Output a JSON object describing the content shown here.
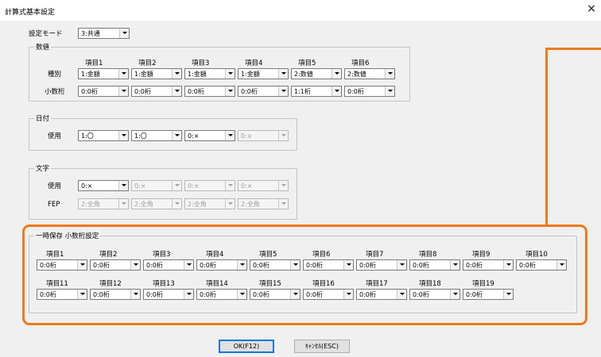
{
  "window": {
    "title": "計算式基本設定",
    "close_glyph": "×"
  },
  "mode": {
    "label": "設定モード",
    "value": "3:共通"
  },
  "numeric": {
    "title": "数値",
    "headers": [
      "項目1",
      "項目2",
      "項目3",
      "項目4",
      "項目5",
      "項目6"
    ],
    "type_label": "種別",
    "type_values": [
      "1:金額",
      "1:金額",
      "1:金額",
      "1:金額",
      "2:数値",
      "2:数値"
    ],
    "decimal_label": "小数桁",
    "decimal_values": [
      "0:0桁",
      "0:0桁",
      "0:0桁",
      "0:0桁",
      "1:1桁",
      "0:0桁"
    ]
  },
  "date": {
    "title": "日付",
    "use_label": "使用",
    "values": [
      "1:〇",
      "1:〇",
      "0:×",
      "0:×"
    ]
  },
  "text": {
    "title": "文字",
    "use_label": "使用",
    "use_values": [
      "0:×",
      "0:×",
      "0:×",
      "0:×"
    ],
    "fep_label": "FEP",
    "fep_values": [
      "2:全角",
      "2:全角",
      "2:全角",
      "2:全角"
    ]
  },
  "temp": {
    "title": "一時保存 小数桁設定",
    "row1_headers": [
      "項目1",
      "項目2",
      "項目3",
      "項目4",
      "項目5",
      "項目6",
      "項目7",
      "項目8",
      "項目9",
      "項目10"
    ],
    "row1_values": [
      "0:0桁",
      "0:0桁",
      "0:0桁",
      "0:0桁",
      "0:0桁",
      "0:0桁",
      "0:0桁",
      "0:0桁",
      "0:0桁",
      "0:0桁"
    ],
    "row2_headers": [
      "項目11",
      "項目12",
      "項目13",
      "項目14",
      "項目15",
      "項目16",
      "項目17",
      "項目18",
      "項目19"
    ],
    "row2_values": [
      "0:0桁",
      "0:0桁",
      "0:0桁",
      "0:0桁",
      "0:0桁",
      "0:0桁",
      "0:0桁",
      "0:0桁",
      "0:0桁"
    ]
  },
  "buttons": {
    "ok": "OK(F12)",
    "cancel": "ｷｬﾝｾﾙ(ESC)"
  },
  "colors": {
    "highlight": "#ec7a1c",
    "focus": "#0078d7"
  }
}
